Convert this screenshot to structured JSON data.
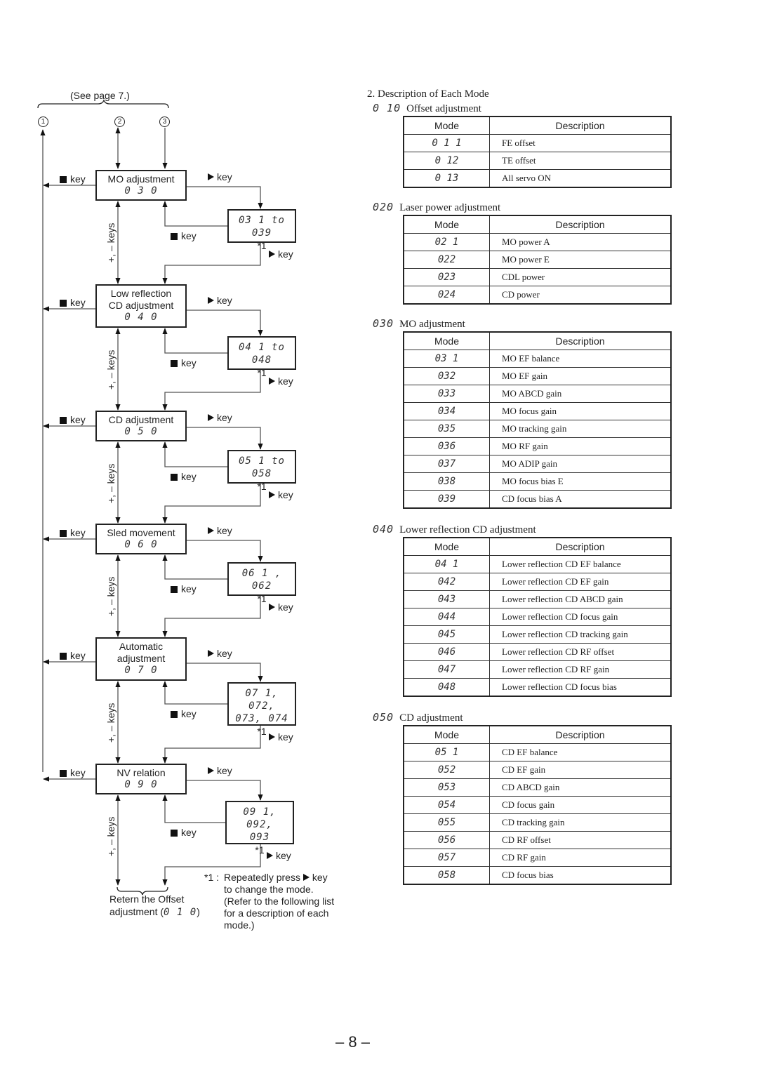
{
  "flowchart": {
    "see_page": "(See page 7.)",
    "entry_points": [
      "1",
      "2",
      "3"
    ],
    "key_stop": "key",
    "key_play": "key",
    "plus_minus_keys": "+, – keys",
    "stop_icon": "square-stop-icon",
    "play_icon": "triangle-play-icon",
    "modes": [
      {
        "name": "MO adjustment",
        "code": "0 3 0",
        "sub_line1": "03 1 to 039",
        "sub_line2": "",
        "note": "*1"
      },
      {
        "name": "Low reflection CD adjustment",
        "name_line1": "Low reflection",
        "name_line2": "CD adjustment",
        "code": "0 4 0",
        "sub_line1": "04 1 to 048",
        "sub_line2": "",
        "note": "*1"
      },
      {
        "name": "CD adjustment",
        "code": "0 5 0",
        "sub_line1": "05 1 to 058",
        "sub_line2": "",
        "note": "*1"
      },
      {
        "name": "Sled movement",
        "code": "0 6 0",
        "sub_line1": "06 1 , 062",
        "sub_line2": "",
        "note": "*1"
      },
      {
        "name": "Automatic adjustment",
        "name_line1": "Automatic",
        "name_line2": "adjustment",
        "code": "0 7 0",
        "sub_line1": "07 1, 072,",
        "sub_line2": "073, 074",
        "note": "*1"
      },
      {
        "name": "NV relation",
        "code": "0 9 0",
        "sub_line1": "09 1, 092,",
        "sub_line2": "093",
        "note": "*1"
      }
    ],
    "return_label_line1": "Retern the Offset",
    "return_label_line2_prefix": "adjustment (",
    "return_label_code": "0 1 0",
    "return_label_line2_suffix": ")",
    "footnote_marker": "*1 :",
    "footnote_line1": "Repeatedly press",
    "footnote_line1_key": "key",
    "footnote_line2": "to change the mode.",
    "footnote_line3": "(Refer to the following list",
    "footnote_line4": "for a description of each",
    "footnote_line5": "mode.)"
  },
  "description": {
    "heading": "2.  Description of Each Mode",
    "col_mode": "Mode",
    "col_description": "Description",
    "sections": [
      {
        "code": "0 10",
        "title": "Offset adjustment",
        "rows": [
          {
            "mode": "0 1 1",
            "desc": "FE offset"
          },
          {
            "mode": "0 12",
            "desc": "TE offset"
          },
          {
            "mode": "0 13",
            "desc": "All servo ON"
          }
        ]
      },
      {
        "code": "020",
        "title": "Laser power adjustment",
        "rows": [
          {
            "mode": "02 1",
            "desc": "MO power A"
          },
          {
            "mode": "022",
            "desc": "MO power E"
          },
          {
            "mode": "023",
            "desc": "CDL power"
          },
          {
            "mode": "024",
            "desc": "CD power"
          }
        ]
      },
      {
        "code": "030",
        "title": "MO adjustment",
        "rows": [
          {
            "mode": "03 1",
            "desc": "MO EF balance"
          },
          {
            "mode": "032",
            "desc": "MO EF gain"
          },
          {
            "mode": "033",
            "desc": "MO ABCD gain"
          },
          {
            "mode": "034",
            "desc": "MO focus gain"
          },
          {
            "mode": "035",
            "desc": "MO tracking gain"
          },
          {
            "mode": "036",
            "desc": "MO RF  gain"
          },
          {
            "mode": "037",
            "desc": "MO ADIP gain"
          },
          {
            "mode": "038",
            "desc": "MO focus bias E"
          },
          {
            "mode": "039",
            "desc": "CD focus bias A"
          }
        ]
      },
      {
        "code": "040",
        "title": "Lower reflection CD adjustment",
        "rows": [
          {
            "mode": "04 1",
            "desc": "Lower reflection CD EF balance"
          },
          {
            "mode": "042",
            "desc": "Lower reflection CD EF gain"
          },
          {
            "mode": "043",
            "desc": "Lower reflection CD ABCD gain"
          },
          {
            "mode": "044",
            "desc": "Lower reflection CD focus gain"
          },
          {
            "mode": "045",
            "desc": "Lower reflection CD tracking gain"
          },
          {
            "mode": "046",
            "desc": "Lower reflection CD RF offset"
          },
          {
            "mode": "047",
            "desc": "Lower reflection CD RF gain"
          },
          {
            "mode": "048",
            "desc": "Lower reflection CD focus bias"
          }
        ]
      },
      {
        "code": "050",
        "title": "CD adjustment",
        "rows": [
          {
            "mode": "05 1",
            "desc": "CD EF balance"
          },
          {
            "mode": "052",
            "desc": "CD EF gain"
          },
          {
            "mode": "053",
            "desc": "CD ABCD gain"
          },
          {
            "mode": "054",
            "desc": "CD focus gain"
          },
          {
            "mode": "055",
            "desc": "CD tracking gain"
          },
          {
            "mode": "056",
            "desc": "CD RF offset"
          },
          {
            "mode": "057",
            "desc": "CD RF gain"
          },
          {
            "mode": "058",
            "desc": "CD focus bias"
          }
        ]
      }
    ]
  },
  "page_number": "– 8 –"
}
